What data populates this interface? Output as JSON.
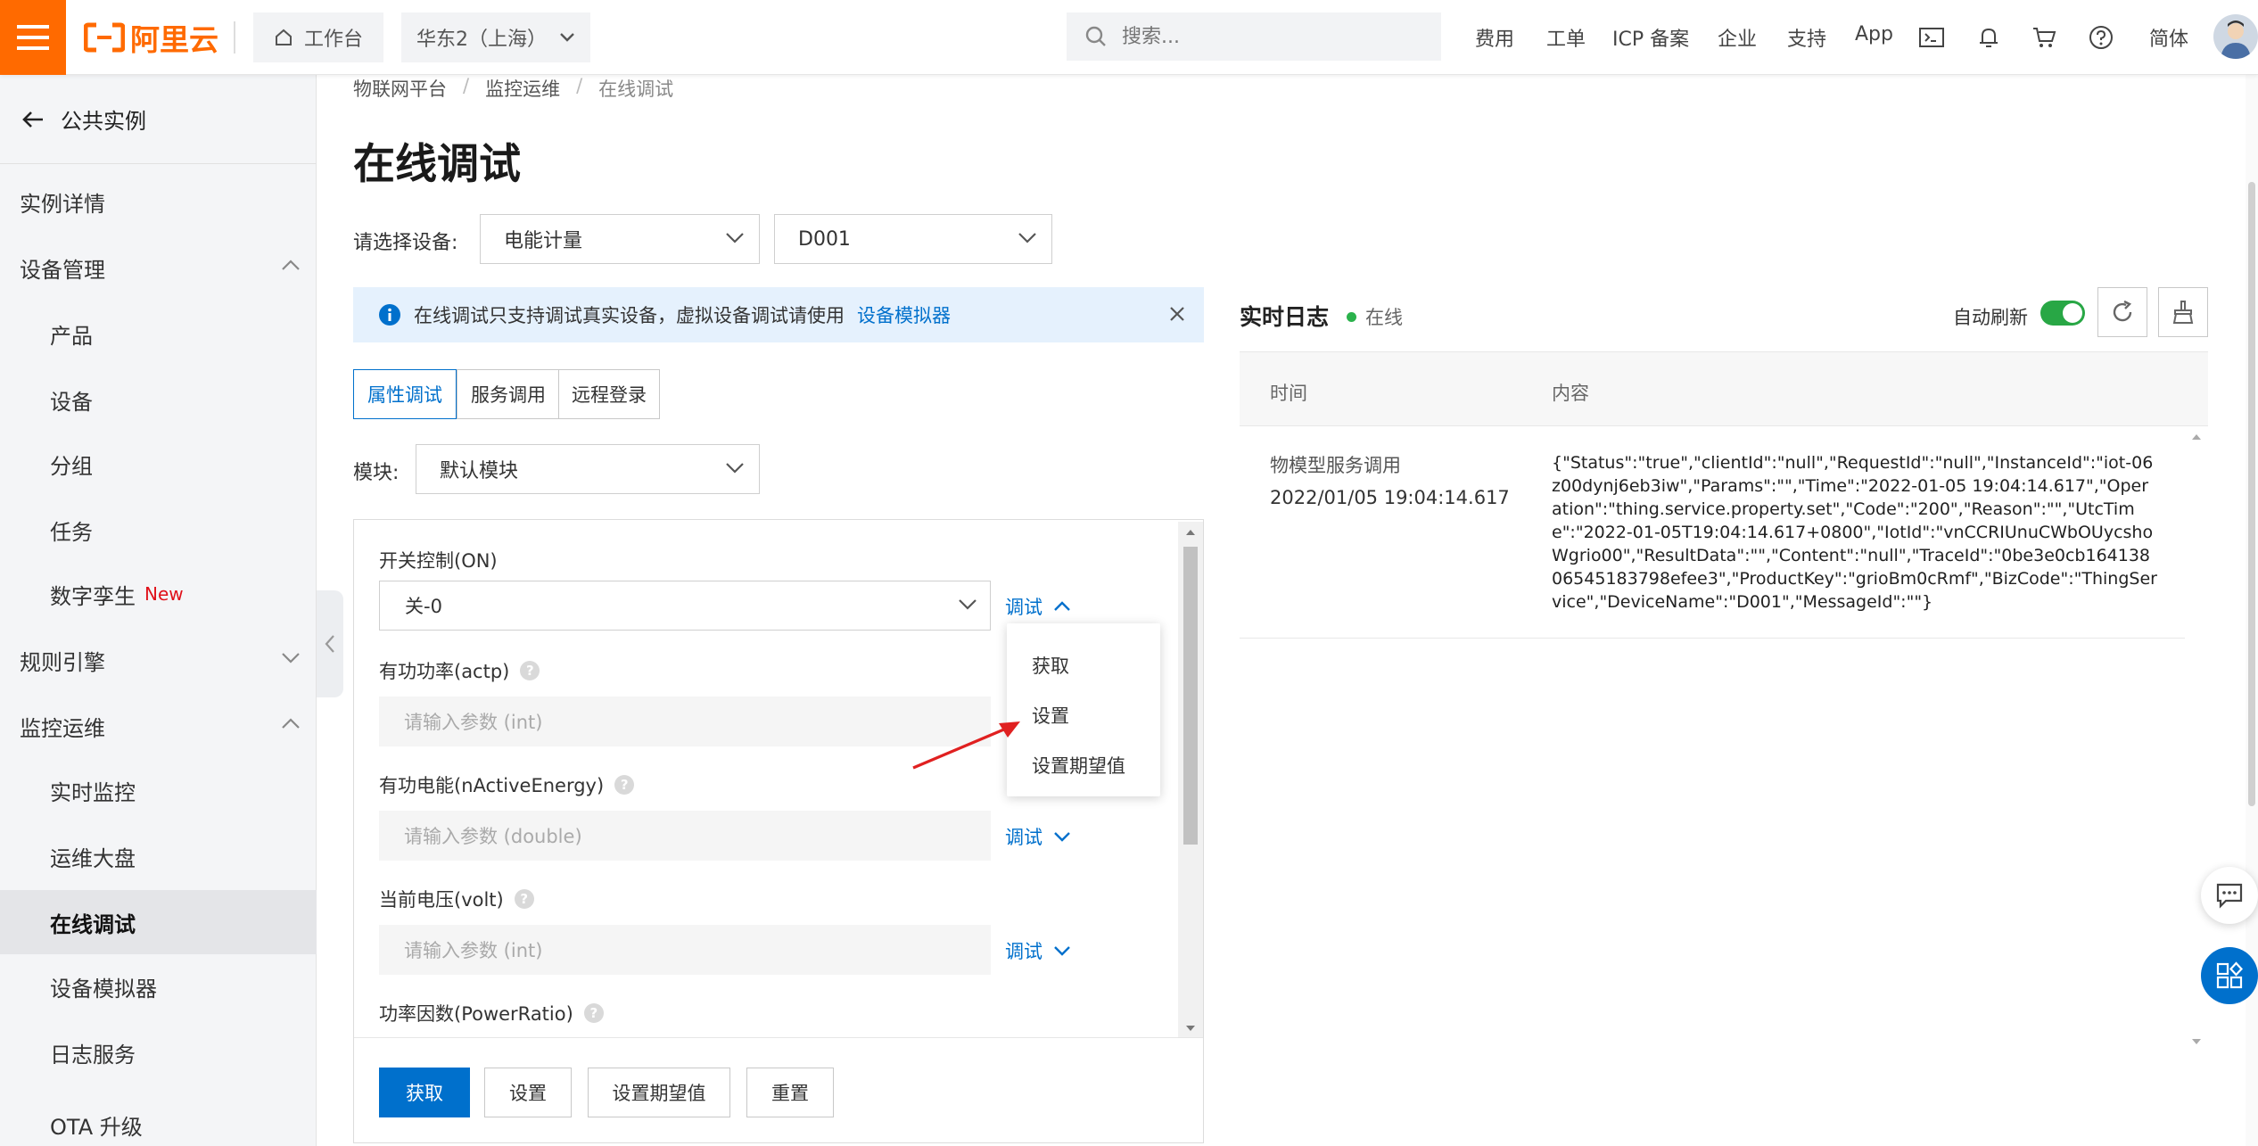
{
  "header": {
    "logo_text": "阿里云",
    "workbench": "工作台",
    "region": "华东2（上海）",
    "search_placeholder": "搜索...",
    "links": [
      "费用",
      "工单",
      "ICP 备案",
      "企业",
      "支持",
      "App"
    ],
    "lang": "简体"
  },
  "sidebar": {
    "back_label": "公共实例",
    "items": [
      {
        "label": "实例详情"
      },
      {
        "label": "设备管理"
      },
      {
        "label": "产品"
      },
      {
        "label": "设备"
      },
      {
        "label": "分组"
      },
      {
        "label": "任务"
      },
      {
        "label": "数字孪生",
        "badge": "New"
      },
      {
        "label": "规则引擎"
      },
      {
        "label": "监控运维"
      },
      {
        "label": "实时监控"
      },
      {
        "label": "运维大盘"
      },
      {
        "label": "在线调试"
      },
      {
        "label": "设备模拟器"
      },
      {
        "label": "日志服务"
      },
      {
        "label": "OTA 升级"
      }
    ]
  },
  "breadcrumb": [
    "物联网平台",
    "监控运维",
    "在线调试"
  ],
  "page_title": "在线调试",
  "device_select": {
    "label": "请选择设备:",
    "product": "电能计量",
    "device": "D001"
  },
  "notice": {
    "text": "在线调试只支持调试真实设备，虚拟设备调试请使用",
    "link": "设备模拟器"
  },
  "tabs": [
    "属性调试",
    "服务调用",
    "远程登录"
  ],
  "module": {
    "label": "模块:",
    "value": "默认模块"
  },
  "properties": [
    {
      "label": "开关控制(ON)",
      "value": "关-0"
    },
    {
      "label": "有功功率(actp)",
      "placeholder": "请输入参数 (int)"
    },
    {
      "label": "有功电能(nActiveEnergy)",
      "placeholder": "请输入参数 (double)"
    },
    {
      "label": "当前电压(volt)",
      "placeholder": "请输入参数 (int)"
    },
    {
      "label": "功率因数(PowerRatio)"
    }
  ],
  "debug_label": "调试",
  "dropdown": [
    "获取",
    "设置",
    "设置期望值"
  ],
  "actions": [
    "获取",
    "设置",
    "设置期望值",
    "重置"
  ],
  "log": {
    "title": "实时日志",
    "status": "在线",
    "auto_refresh": "自动刷新",
    "columns": [
      "时间",
      "内容"
    ],
    "entry": {
      "type": "物模型服务调用",
      "time": "2022/01/05 19:04:14.617",
      "content": "{\"Status\":\"true\",\"clientId\":\"null\",\"RequestId\":\"null\",\"InstanceId\":\"iot-06z00dynj6eb3iw\",\"Params\":\"\",\"Time\":\"2022-01-05 19:04:14.617\",\"Operation\":\"thing.service.property.set\",\"Code\":\"200\",\"Reason\":\"\",\"UtcTime\":\"2022-01-05T19:04:14.617+0800\",\"IotId\":\"vnCCRIUnuCWbOUycshoWgrio00\",\"ResultData\":\"\",\"Content\":\"null\",\"TraceId\":\"0be3e0cb16413806545183798efee3\",\"ProductKey\":\"grioBm0cRmf\",\"BizCode\":\"ThingService\",\"DeviceName\":\"D001\",\"MessageId\":\"\"}"
    }
  },
  "colors": {
    "brand": "#ff6a00",
    "link": "#0070cc",
    "online": "#2bb24c",
    "toggle": "#28a745"
  }
}
